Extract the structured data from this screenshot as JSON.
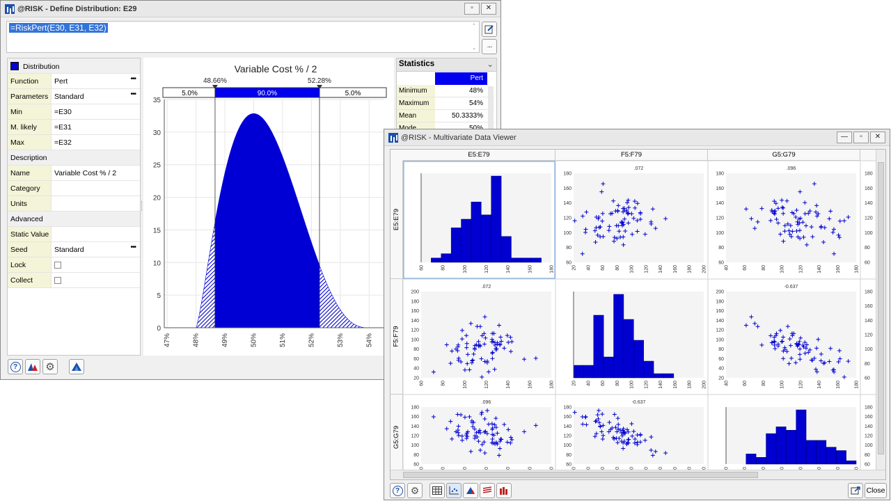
{
  "define_window": {
    "title": "@RISK - Define Distribution: E29",
    "formula": "=RiskPert(E30, E31, E32)",
    "panel": {
      "distribution_header": "Distribution",
      "rows": [
        {
          "label": "Function",
          "value": "Pert",
          "dots": true
        },
        {
          "label": "Parameters",
          "value": "Standard",
          "dots": true
        },
        {
          "label": "Min",
          "value": "=E30"
        },
        {
          "label": "M. likely",
          "value": "=E31"
        },
        {
          "label": "Max",
          "value": "=E32"
        }
      ],
      "description_header": "Description",
      "desc_rows": [
        {
          "label": "Name",
          "value": "Variable Cost % / 2"
        },
        {
          "label": "Category",
          "value": ""
        },
        {
          "label": "Units",
          "value": ""
        }
      ],
      "advanced_header": "Advanced",
      "adv_rows": [
        {
          "label": "Static Value",
          "value": ""
        },
        {
          "label": "Seed",
          "value": "Standard",
          "dots": true
        },
        {
          "label": "Lock",
          "checkbox": true
        },
        {
          "label": "Collect",
          "checkbox": true
        }
      ]
    },
    "chart": {
      "title": "Variable Cost % / 2",
      "left_marker": "48.66%",
      "right_marker": "52.28%",
      "band_left": "5.0%",
      "band_mid": "90.0%",
      "band_right": "5.0%"
    },
    "statistics": {
      "header": "Statistics",
      "column": "Pert",
      "rows": [
        {
          "label": "Minimum",
          "value": "48%"
        },
        {
          "label": "Maximum",
          "value": "54%"
        },
        {
          "label": "Mean",
          "value": "50.3333%"
        },
        {
          "label": "Mode",
          "value": "50%"
        }
      ]
    }
  },
  "chart_data": {
    "type": "area",
    "title": "Variable Cost % / 2",
    "xlabel": "",
    "ylabel": "",
    "xlim": [
      46.9,
      54.5
    ],
    "ylim": [
      0,
      35
    ],
    "x_ticks": [
      "47%",
      "48%",
      "49%",
      "50%",
      "51%",
      "52%",
      "53%",
      "54%"
    ],
    "y_ticks": [
      "0",
      "5",
      "10",
      "15",
      "20",
      "25",
      "30",
      "35"
    ],
    "distribution": {
      "name": "Pert",
      "min": 48,
      "mode": 50,
      "max": 54
    },
    "delimiters": {
      "left": 48.66,
      "right": 52.28
    },
    "bands": [
      5.0,
      90.0,
      5.0
    ],
    "grid": true
  },
  "mv_window": {
    "title": "@RISK - Multivariate Data Viewer",
    "columns": [
      "E5:E79",
      "F5:F79",
      "G5:G79"
    ],
    "rows": [
      "E5:E79",
      "F5:F79",
      "G5:G79"
    ],
    "correlations": {
      "ef": ".072",
      "eg": ".096",
      "fg": "-0.637"
    },
    "close_label": "Close"
  },
  "icons": {
    "help": "help-icon",
    "fit": "fit-distribution-icon",
    "settings": "gear-icon",
    "triangle": "triangle-chart-icon"
  },
  "colors": {
    "accent": "#0000d4",
    "band": "#0000ee",
    "title_bar": "#e8e8e8"
  }
}
